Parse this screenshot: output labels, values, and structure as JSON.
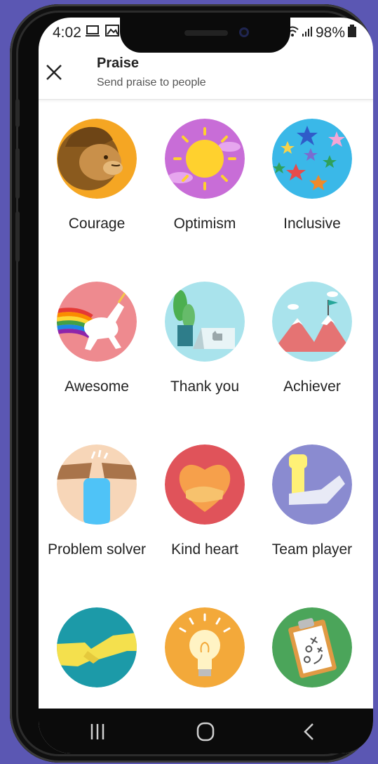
{
  "status": {
    "time": "4:02",
    "battery": "98%"
  },
  "header": {
    "title": "Praise",
    "subtitle": "Send praise to people"
  },
  "badges": [
    {
      "label": "Courage",
      "icon": "lion-icon"
    },
    {
      "label": "Optimism",
      "icon": "sun-icon"
    },
    {
      "label": "Inclusive",
      "icon": "stars-icon"
    },
    {
      "label": "Awesome",
      "icon": "unicorn-icon"
    },
    {
      "label": "Thank you",
      "icon": "thank-you-card-icon"
    },
    {
      "label": "Achiever",
      "icon": "mountain-flag-icon"
    },
    {
      "label": "Problem solver",
      "icon": "fist-icon"
    },
    {
      "label": "Kind heart",
      "icon": "heart-hands-icon"
    },
    {
      "label": "Team player",
      "icon": "arms-icon"
    },
    {
      "label": "",
      "icon": "handshake-icon"
    },
    {
      "label": "",
      "icon": "lightbulb-icon"
    },
    {
      "label": "",
      "icon": "clipboard-icon"
    }
  ],
  "colors": {
    "courage": "#f5a623",
    "optimism": "#c86dd7",
    "inclusive": "#3ab8e8",
    "awesome": "#ee8a8f",
    "thank_you": "#a9e3ec",
    "achiever": "#a9e3ec",
    "problem_solver": "#f7d6b8",
    "kind_heart": "#e0535a",
    "team_player": "#8a8bd0",
    "teal": "#1c9aa8",
    "gold": "#f3a93a",
    "green": "#4ba55a"
  }
}
